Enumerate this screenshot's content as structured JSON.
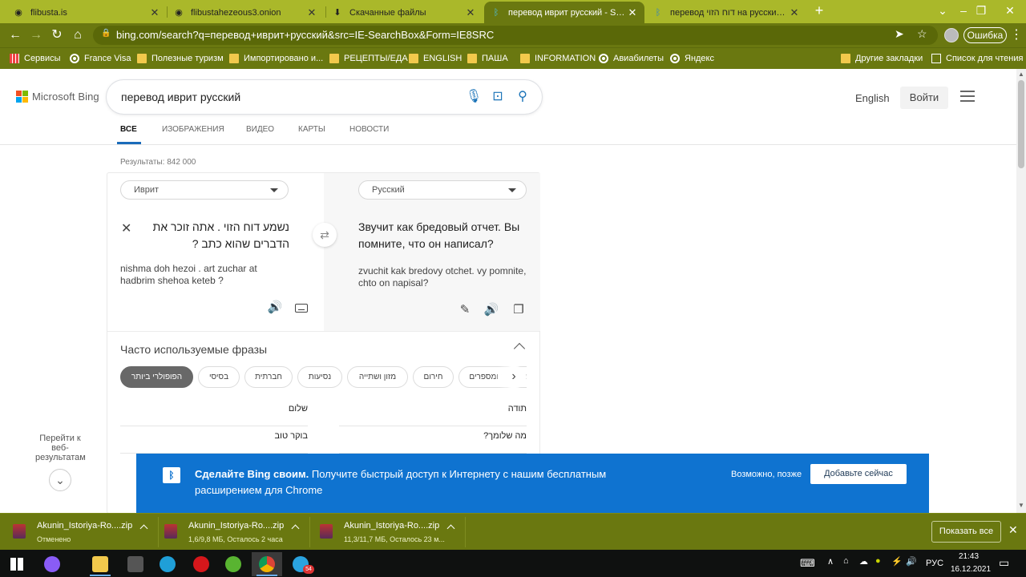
{
  "browser": {
    "tabs": [
      {
        "title": "flibusta.is",
        "active": false
      },
      {
        "title": "flibustahezeous3.onion",
        "active": false
      },
      {
        "title": "Скачанные файлы",
        "active": false
      },
      {
        "title": "перевод иврит русский - Search",
        "active": true
      },
      {
        "title": "перевод דוח הזוי на русский - Se",
        "active": false
      }
    ],
    "new_tab": "+",
    "url": "bing.com/search?q=перевод+иврит+русский&src=IE-SearchBox&Form=IE8SRC",
    "error_button": "Ошибка",
    "bookmarks": [
      {
        "label": "Сервисы",
        "icon": "apps-icon"
      },
      {
        "label": "France Visa",
        "icon": "globe-icon"
      },
      {
        "label": "Полезные туризм",
        "icon": "folder-icon"
      },
      {
        "label": "Импортировано и...",
        "icon": "folder-icon"
      },
      {
        "label": "РЕЦЕПТЫ/ЕДА",
        "icon": "folder-icon"
      },
      {
        "label": "ENGLISH",
        "icon": "folder-icon"
      },
      {
        "label": "ПАША",
        "icon": "folder-icon"
      },
      {
        "label": "INFORMATION",
        "icon": "folder-icon"
      },
      {
        "label": "Авиабилеты",
        "icon": "globe-icon"
      },
      {
        "label": "Яндекс",
        "icon": "globe-icon"
      }
    ],
    "other_bookmarks": "Другие закладки",
    "reading_list": "Список для чтения"
  },
  "bing": {
    "logo_text": "Microsoft Bing",
    "query": "перевод иврит русский",
    "header_lang": "English",
    "login": "Войти",
    "nav": [
      "ВСЕ",
      "ИЗОБРАЖЕНИЯ",
      "ВИДЕО",
      "КАРТЫ",
      "НОВОСТИ"
    ],
    "results_count": "Результаты: 842 000",
    "translator": {
      "source_lang": "Иврит",
      "target_lang": "Русский",
      "source_text": "נשמע דוח הזוי . אתה זוכר את הדברים שהוא כתב ?",
      "source_translit": "nishma doh hezoi . art zuchar at hadbrim shehoa keteb ?",
      "target_text": "Звучит как бредовый отчет. Вы помните, что он написал?",
      "target_translit": "zvuchit kak bredovy otchet. vy pomnite, chto on napisal?"
    },
    "phrases": {
      "title": "Часто используемые фразы",
      "chips": [
        "הפופולרי ביותר",
        "בסיסי",
        "חברתית",
        "נסיעות",
        "מזון ושתייה",
        "חירום",
        "מספרים ומספרים"
      ],
      "rows_left": [
        "שלום",
        "בוקר טוב"
      ],
      "rows_right": [
        "תודה",
        "מה שלומך?"
      ]
    },
    "goto_results": "Перейти к веб-результатам",
    "banner": {
      "bold": "Сделайте Bing своим.",
      "text": " Получите быстрый доступ к Интернету с нашим бесплатным расширением для Chrome",
      "maybe_later": "Возможно, позже",
      "add_now": "Добавьте сейчас",
      "color": "#0f73d0"
    }
  },
  "downloads": [
    {
      "name": "Akunin_Istoriya-Ro....zip",
      "status": "Отменено"
    },
    {
      "name": "Akunin_Istoriya-Ro....zip",
      "status": "1,6/9,8 МБ, Осталось 2 часа"
    },
    {
      "name": "Akunin_Istoriya-Ro....zip",
      "status": "11,3/11,7 МБ, Осталось 23 м..."
    }
  ],
  "show_all": "Показать все",
  "taskbar": {
    "badge": "54",
    "lang": "РУС",
    "time": "21:43",
    "date": "16.12.2021"
  },
  "colors": {
    "chrome_frame": "#6a7810",
    "tabstrip": "#aab82a",
    "bing_blue": "#1a6bba"
  }
}
